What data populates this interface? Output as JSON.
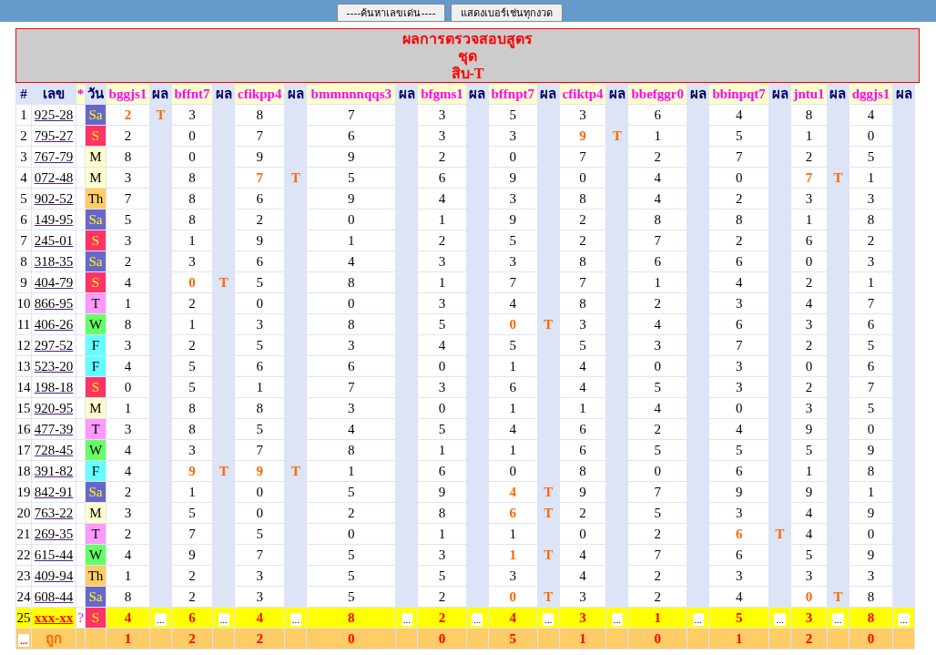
{
  "toolbar": {
    "buttons": [
      "----ค้นหาเลขเด่น----",
      "แสดงเบอร์เช่นทุกงวด"
    ]
  },
  "title": {
    "lines": [
      "ผลการตรวจสอบสูตร",
      "ชุด",
      "สิบ-T"
    ]
  },
  "table": {
    "columns": {
      "index": "#",
      "number": "เลข",
      "star": "*",
      "day": "วัน",
      "formulas": [
        {
          "name": "bggjs1",
          "result_header": "ผล"
        },
        {
          "name": "bffnt7",
          "result_header": "ผล"
        },
        {
          "name": "cfikpp4",
          "result_header": "ผล"
        },
        {
          "name": "bmmnnnqqs3",
          "result_header": "ผล"
        },
        {
          "name": "bfgms1",
          "result_header": "ผล"
        },
        {
          "name": "bffnpt7",
          "result_header": "ผล"
        },
        {
          "name": "cfiktp4",
          "result_header": "ผล"
        },
        {
          "name": "bbefggr0",
          "result_header": "ผล"
        },
        {
          "name": "bbinpqt7",
          "result_header": "ผล"
        },
        {
          "name": "jntu1",
          "result_header": "ผล"
        },
        {
          "name": "dggjs1",
          "result_header": "ผล"
        }
      ]
    },
    "rows": [
      {
        "index": "1",
        "number": "925-28",
        "day": "Sa",
        "color": "#6666cc",
        "cells": [
          {
            "value": "2",
            "result": "T"
          },
          {
            "value": "3"
          },
          {
            "value": "8"
          },
          {
            "value": "7"
          },
          {
            "value": "3"
          },
          {
            "value": "5"
          },
          {
            "value": "3"
          },
          {
            "value": "6"
          },
          {
            "value": "4"
          },
          {
            "value": "8"
          },
          {
            "value": "4"
          }
        ]
      },
      {
        "index": "2",
        "number": "795-27",
        "day": "S",
        "color": "#ff3366",
        "cells": [
          {
            "value": "2"
          },
          {
            "value": "0"
          },
          {
            "value": "7"
          },
          {
            "value": "6"
          },
          {
            "value": "3"
          },
          {
            "value": "3"
          },
          {
            "value": "9",
            "result": "T"
          },
          {
            "value": "1"
          },
          {
            "value": "5"
          },
          {
            "value": "1"
          },
          {
            "value": "0"
          }
        ]
      },
      {
        "index": "3",
        "number": "767-79",
        "day": "M",
        "color": "#ffffcc",
        "cells": [
          {
            "value": "8"
          },
          {
            "value": "0"
          },
          {
            "value": "9"
          },
          {
            "value": "9"
          },
          {
            "value": "2"
          },
          {
            "value": "0"
          },
          {
            "value": "7"
          },
          {
            "value": "2"
          },
          {
            "value": "7"
          },
          {
            "value": "2"
          },
          {
            "value": "5"
          }
        ]
      },
      {
        "index": "4",
        "number": "072-48",
        "day": "M",
        "color": "#ffffcc",
        "cells": [
          {
            "value": "3"
          },
          {
            "value": "8"
          },
          {
            "value": "7",
            "result": "T"
          },
          {
            "value": "5"
          },
          {
            "value": "6"
          },
          {
            "value": "9"
          },
          {
            "value": "0"
          },
          {
            "value": "4"
          },
          {
            "value": "0"
          },
          {
            "value": "7",
            "result": "T"
          },
          {
            "value": "1"
          }
        ]
      },
      {
        "index": "5",
        "number": "902-52",
        "day": "Th",
        "color": "#ffcc66",
        "cells": [
          {
            "value": "7"
          },
          {
            "value": "8"
          },
          {
            "value": "6"
          },
          {
            "value": "9"
          },
          {
            "value": "4"
          },
          {
            "value": "3"
          },
          {
            "value": "8"
          },
          {
            "value": "4"
          },
          {
            "value": "2"
          },
          {
            "value": "3"
          },
          {
            "value": "3"
          }
        ]
      },
      {
        "index": "6",
        "number": "149-95",
        "day": "Sa",
        "color": "#6666cc",
        "cells": [
          {
            "value": "5"
          },
          {
            "value": "8"
          },
          {
            "value": "2"
          },
          {
            "value": "0"
          },
          {
            "value": "1"
          },
          {
            "value": "9"
          },
          {
            "value": "2"
          },
          {
            "value": "8"
          },
          {
            "value": "8"
          },
          {
            "value": "1"
          },
          {
            "value": "8"
          }
        ]
      },
      {
        "index": "7",
        "number": "245-01",
        "day": "S",
        "color": "#ff3366",
        "cells": [
          {
            "value": "3"
          },
          {
            "value": "1"
          },
          {
            "value": "9"
          },
          {
            "value": "1"
          },
          {
            "value": "2"
          },
          {
            "value": "5"
          },
          {
            "value": "2"
          },
          {
            "value": "7"
          },
          {
            "value": "2"
          },
          {
            "value": "6"
          },
          {
            "value": "2"
          }
        ]
      },
      {
        "index": "8",
        "number": "318-35",
        "day": "Sa",
        "color": "#6666cc",
        "cells": [
          {
            "value": "2"
          },
          {
            "value": "3"
          },
          {
            "value": "6"
          },
          {
            "value": "4"
          },
          {
            "value": "3"
          },
          {
            "value": "3"
          },
          {
            "value": "8"
          },
          {
            "value": "6"
          },
          {
            "value": "6"
          },
          {
            "value": "0"
          },
          {
            "value": "3"
          }
        ]
      },
      {
        "index": "9",
        "number": "404-79",
        "day": "S",
        "color": "#ff3366",
        "cells": [
          {
            "value": "4"
          },
          {
            "value": "0",
            "result": "T"
          },
          {
            "value": "5"
          },
          {
            "value": "8"
          },
          {
            "value": "1"
          },
          {
            "value": "7"
          },
          {
            "value": "7"
          },
          {
            "value": "1"
          },
          {
            "value": "4"
          },
          {
            "value": "2"
          },
          {
            "value": "1"
          }
        ]
      },
      {
        "index": "10",
        "number": "866-95",
        "day": "T",
        "color": "#ff99ff",
        "cells": [
          {
            "value": "1"
          },
          {
            "value": "2"
          },
          {
            "value": "0"
          },
          {
            "value": "0"
          },
          {
            "value": "3"
          },
          {
            "value": "4"
          },
          {
            "value": "8"
          },
          {
            "value": "2"
          },
          {
            "value": "3"
          },
          {
            "value": "4"
          },
          {
            "value": "7"
          }
        ]
      },
      {
        "index": "11",
        "number": "406-26",
        "day": "W",
        "color": "#66ff66",
        "cells": [
          {
            "value": "8"
          },
          {
            "value": "1"
          },
          {
            "value": "3"
          },
          {
            "value": "8"
          },
          {
            "value": "5"
          },
          {
            "value": "0",
            "result": "T"
          },
          {
            "value": "3"
          },
          {
            "value": "4"
          },
          {
            "value": "6"
          },
          {
            "value": "3"
          },
          {
            "value": "6"
          }
        ]
      },
      {
        "index": "12",
        "number": "297-52",
        "day": "F",
        "color": "#66ffff",
        "cells": [
          {
            "value": "3"
          },
          {
            "value": "2"
          },
          {
            "value": "5"
          },
          {
            "value": "3"
          },
          {
            "value": "4"
          },
          {
            "value": "5"
          },
          {
            "value": "5"
          },
          {
            "value": "3"
          },
          {
            "value": "7"
          },
          {
            "value": "2"
          },
          {
            "value": "5"
          }
        ]
      },
      {
        "index": "13",
        "number": "523-20",
        "day": "F",
        "color": "#66ffff",
        "cells": [
          {
            "value": "4"
          },
          {
            "value": "5"
          },
          {
            "value": "6"
          },
          {
            "value": "6"
          },
          {
            "value": "0"
          },
          {
            "value": "1"
          },
          {
            "value": "4"
          },
          {
            "value": "0"
          },
          {
            "value": "3"
          },
          {
            "value": "0"
          },
          {
            "value": "6"
          }
        ]
      },
      {
        "index": "14",
        "number": "198-18",
        "day": "S",
        "color": "#ff3366",
        "cells": [
          {
            "value": "0"
          },
          {
            "value": "5"
          },
          {
            "value": "1"
          },
          {
            "value": "7"
          },
          {
            "value": "3"
          },
          {
            "value": "6"
          },
          {
            "value": "4"
          },
          {
            "value": "5"
          },
          {
            "value": "3"
          },
          {
            "value": "2"
          },
          {
            "value": "7"
          }
        ]
      },
      {
        "index": "15",
        "number": "920-95",
        "day": "M",
        "color": "#ffffcc",
        "cells": [
          {
            "value": "1"
          },
          {
            "value": "8"
          },
          {
            "value": "8"
          },
          {
            "value": "3"
          },
          {
            "value": "0"
          },
          {
            "value": "1"
          },
          {
            "value": "1"
          },
          {
            "value": "4"
          },
          {
            "value": "0"
          },
          {
            "value": "3"
          },
          {
            "value": "5"
          }
        ]
      },
      {
        "index": "16",
        "number": "477-39",
        "day": "T",
        "color": "#ff99ff",
        "cells": [
          {
            "value": "3"
          },
          {
            "value": "8"
          },
          {
            "value": "5"
          },
          {
            "value": "4"
          },
          {
            "value": "5"
          },
          {
            "value": "4"
          },
          {
            "value": "6"
          },
          {
            "value": "2"
          },
          {
            "value": "4"
          },
          {
            "value": "9"
          },
          {
            "value": "0"
          }
        ]
      },
      {
        "index": "17",
        "number": "728-45",
        "day": "W",
        "color": "#66ff66",
        "cells": [
          {
            "value": "4"
          },
          {
            "value": "3"
          },
          {
            "value": "7"
          },
          {
            "value": "8"
          },
          {
            "value": "1"
          },
          {
            "value": "1"
          },
          {
            "value": "6"
          },
          {
            "value": "5"
          },
          {
            "value": "5"
          },
          {
            "value": "5"
          },
          {
            "value": "9"
          }
        ]
      },
      {
        "index": "18",
        "number": "391-82",
        "day": "F",
        "color": "#66ffff",
        "cells": [
          {
            "value": "4"
          },
          {
            "value": "9",
            "result": "T"
          },
          {
            "value": "9",
            "result": "T"
          },
          {
            "value": "1"
          },
          {
            "value": "6"
          },
          {
            "value": "0"
          },
          {
            "value": "8"
          },
          {
            "value": "0"
          },
          {
            "value": "6"
          },
          {
            "value": "1"
          },
          {
            "value": "8"
          }
        ]
      },
      {
        "index": "19",
        "number": "842-91",
        "day": "Sa",
        "color": "#6666cc",
        "cells": [
          {
            "value": "2"
          },
          {
            "value": "1"
          },
          {
            "value": "0"
          },
          {
            "value": "5"
          },
          {
            "value": "9"
          },
          {
            "value": "4",
            "result": "T"
          },
          {
            "value": "9"
          },
          {
            "value": "7"
          },
          {
            "value": "9"
          },
          {
            "value": "9"
          },
          {
            "value": "1"
          }
        ]
      },
      {
        "index": "20",
        "number": "763-22",
        "day": "M",
        "color": "#ffffcc",
        "cells": [
          {
            "value": "3"
          },
          {
            "value": "5"
          },
          {
            "value": "0"
          },
          {
            "value": "2"
          },
          {
            "value": "8"
          },
          {
            "value": "6",
            "result": "T"
          },
          {
            "value": "2"
          },
          {
            "value": "5"
          },
          {
            "value": "3"
          },
          {
            "value": "4"
          },
          {
            "value": "9"
          }
        ]
      },
      {
        "index": "21",
        "number": "269-35",
        "day": "T",
        "color": "#ff99ff",
        "cells": [
          {
            "value": "2"
          },
          {
            "value": "7"
          },
          {
            "value": "5"
          },
          {
            "value": "0"
          },
          {
            "value": "1"
          },
          {
            "value": "1"
          },
          {
            "value": "0"
          },
          {
            "value": "2"
          },
          {
            "value": "6",
            "result": "T"
          },
          {
            "value": "4"
          },
          {
            "value": "0"
          }
        ]
      },
      {
        "index": "22",
        "number": "615-44",
        "day": "W",
        "color": "#66ff66",
        "cells": [
          {
            "value": "4"
          },
          {
            "value": "9"
          },
          {
            "value": "7"
          },
          {
            "value": "5"
          },
          {
            "value": "3"
          },
          {
            "value": "1",
            "result": "T"
          },
          {
            "value": "4"
          },
          {
            "value": "7"
          },
          {
            "value": "6"
          },
          {
            "value": "5"
          },
          {
            "value": "9"
          }
        ]
      },
      {
        "index": "23",
        "number": "409-94",
        "day": "Th",
        "color": "#ffcc66",
        "cells": [
          {
            "value": "1"
          },
          {
            "value": "2"
          },
          {
            "value": "3"
          },
          {
            "value": "5"
          },
          {
            "value": "5"
          },
          {
            "value": "3"
          },
          {
            "value": "4"
          },
          {
            "value": "2"
          },
          {
            "value": "3"
          },
          {
            "value": "3"
          },
          {
            "value": "3"
          }
        ]
      },
      {
        "index": "24",
        "number": "608-44",
        "day": "Sa",
        "color": "#6666cc",
        "cells": [
          {
            "value": "8"
          },
          {
            "value": "2"
          },
          {
            "value": "3"
          },
          {
            "value": "5"
          },
          {
            "value": "2"
          },
          {
            "value": "0",
            "result": "T"
          },
          {
            "value": "3"
          },
          {
            "value": "2"
          },
          {
            "value": "4"
          },
          {
            "value": "0",
            "result": "T"
          },
          {
            "value": "8"
          }
        ]
      }
    ],
    "pending_row": {
      "index": "25",
      "number": "xxx-xx",
      "star": "?",
      "day": "S",
      "color": "#ff3366",
      "cells": [
        {
          "value": "4",
          "result": "..."
        },
        {
          "value": "6",
          "result": "..."
        },
        {
          "value": "4",
          "result": "..."
        },
        {
          "value": "8",
          "result": "..."
        },
        {
          "value": "2",
          "result": "..."
        },
        {
          "value": "4",
          "result": "..."
        },
        {
          "value": "3",
          "result": "..."
        },
        {
          "value": "1",
          "result": "..."
        },
        {
          "value": "5",
          "result": "..."
        },
        {
          "value": "3",
          "result": "..."
        },
        {
          "value": "8",
          "result": "..."
        }
      ]
    },
    "totals_row": {
      "index": "...",
      "label": "ถูก",
      "counts": [
        "1",
        "2",
        "2",
        "0",
        "0",
        "5",
        "1",
        "0",
        "1",
        "2",
        "0"
      ]
    }
  }
}
